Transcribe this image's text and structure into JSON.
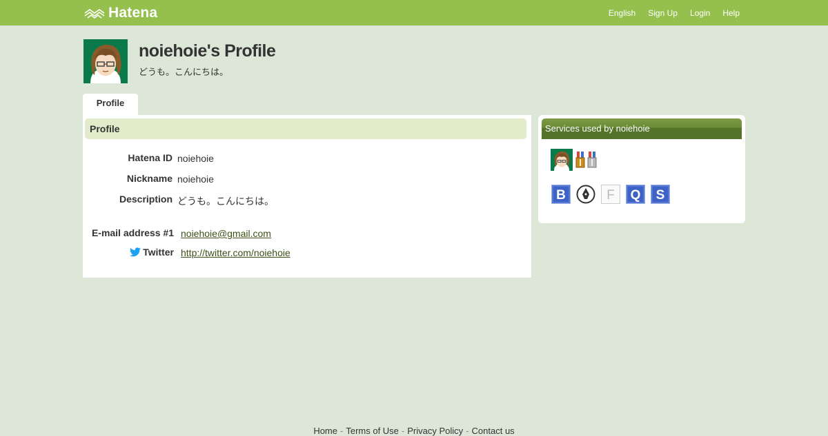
{
  "brand": {
    "name": "Hatena"
  },
  "topnav": {
    "english": "English",
    "signup": "Sign Up",
    "login": "Login",
    "help": "Help"
  },
  "header": {
    "title": "noiehoie's Profile",
    "subtitle": "どうも。こんにちは。"
  },
  "tabs": [
    {
      "label": "Profile"
    }
  ],
  "profile": {
    "section_title": "Profile",
    "fields": [
      {
        "label": "Hatena ID",
        "value": "noiehoie"
      },
      {
        "label": "Nickname",
        "value": "noiehoie"
      },
      {
        "label": "Description",
        "value": "どうも。こんにちは。"
      }
    ],
    "contacts": [
      {
        "label": "E-mail address #1",
        "value": "noiehoie@gmail.com"
      },
      {
        "label": "Twitter",
        "value": "http://twitter.com/noiehoie",
        "icon": "twitter-bird-icon"
      }
    ]
  },
  "services": {
    "title": "Services used by noiehoie",
    "icons": [
      "bookmark-b-icon",
      "fountain-pen-icon",
      "fotolife-f-icon",
      "question-q-icon",
      "star-s-icon"
    ],
    "medals": [
      "gold-medal-icon",
      "silver-medal-icon"
    ]
  },
  "footer": {
    "links": [
      "Home",
      "Terms of Use",
      "Privacy Policy",
      "Contact us"
    ]
  },
  "colors": {
    "topbar": "#96c04e",
    "background": "#dde7d8",
    "section_header": "#e3ecca",
    "side_header": "#5f7f30",
    "link": "#3c4f14",
    "service_icon_blue": "#3d63c7"
  }
}
